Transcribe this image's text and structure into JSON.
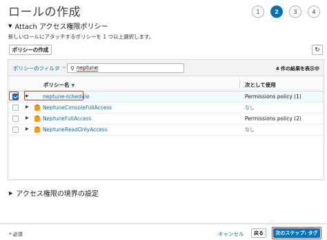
{
  "page": {
    "title": "ロールの作成"
  },
  "steps": [
    "1",
    "2",
    "3",
    "4"
  ],
  "active_step": 2,
  "attach_section": {
    "title": "Attach アクセス権限ポリシー",
    "description": "新しいロールにアタッチするポリシーを 1 つ以上選択します。",
    "create_policy_label": "ポリシーの作成",
    "refresh_icon": "refresh-icon"
  },
  "filter": {
    "label": "ポリシーのフィルタ",
    "search_value": "neptune",
    "result_count": "4 件の結果を表示中"
  },
  "table": {
    "headers": {
      "name": "ポリシー名",
      "used_as": "次として使用"
    },
    "rows": [
      {
        "name": "neptune-schedule",
        "used_as": "Permissions policy (1)",
        "checked": true,
        "icon": "expand"
      },
      {
        "name": "NeptuneConsoleFullAccess",
        "used_as": "なし",
        "checked": false,
        "icon": "aws-managed-policy-icon"
      },
      {
        "name": "NeptuneFullAccess",
        "used_as": "Permissions policy (2)",
        "checked": false,
        "icon": "aws-managed-policy-icon"
      },
      {
        "name": "NeptuneReadOnlyAccess",
        "used_as": "なし",
        "checked": false,
        "icon": "aws-managed-policy-icon"
      }
    ]
  },
  "boundary_section": {
    "title": "アクセス権限の境界の設定"
  },
  "footer": {
    "required": "* 必須",
    "cancel": "キャンセル",
    "back": "戻る",
    "next": "次のステップ: タグ"
  },
  "colors": {
    "accent": "#0073bb",
    "highlight": "#d13212",
    "policy_icon": "#f90"
  }
}
